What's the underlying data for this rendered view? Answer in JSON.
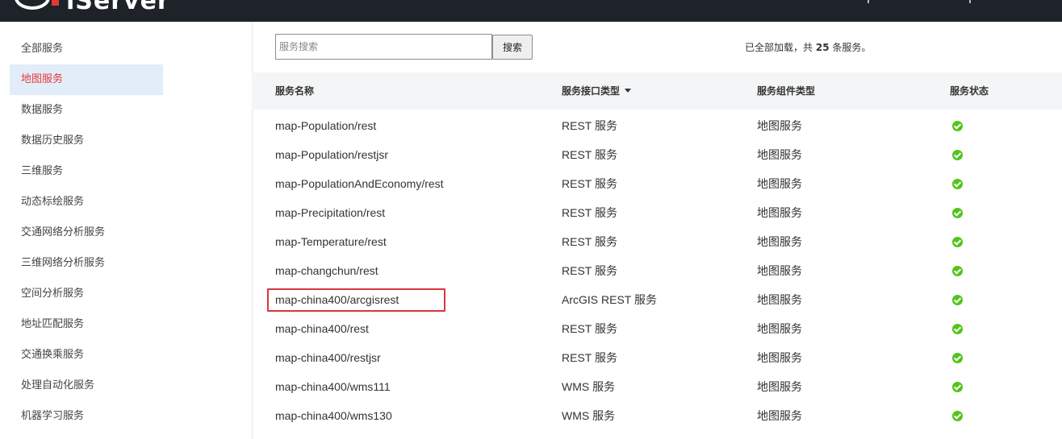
{
  "header": {
    "logo_text": "iServer"
  },
  "sidebar": {
    "items": [
      {
        "label": "全部服务"
      },
      {
        "label": "地图服务"
      },
      {
        "label": "数据服务"
      },
      {
        "label": "数据历史服务"
      },
      {
        "label": "三维服务"
      },
      {
        "label": "动态标绘服务"
      },
      {
        "label": "交通网络分析服务"
      },
      {
        "label": "三维网络分析服务"
      },
      {
        "label": "空间分析服务"
      },
      {
        "label": "地址匹配服务"
      },
      {
        "label": "交通换乘服务"
      },
      {
        "label": "处理自动化服务"
      },
      {
        "label": "机器学习服务"
      }
    ],
    "active_index": 1
  },
  "search": {
    "placeholder": "服务搜索",
    "value": "",
    "button_label": "搜索"
  },
  "summary": {
    "prefix": "已全部加载，共",
    "count": "25",
    "suffix": "条服务。"
  },
  "table": {
    "columns": [
      "服务名称",
      "服务接口类型",
      "服务组件类型",
      "服务状态"
    ],
    "sorted_column": "服务接口类型",
    "rows": [
      {
        "name": "map-Population/rest",
        "iface": "REST 服务",
        "comp": "地图服务",
        "status": "ok"
      },
      {
        "name": "map-Population/restjsr",
        "iface": "REST 服务",
        "comp": "地图服务",
        "status": "ok"
      },
      {
        "name": "map-PopulationAndEconomy/rest",
        "iface": "REST 服务",
        "comp": "地图服务",
        "status": "ok"
      },
      {
        "name": "map-Precipitation/rest",
        "iface": "REST 服务",
        "comp": "地图服务",
        "status": "ok"
      },
      {
        "name": "map-Temperature/rest",
        "iface": "REST 服务",
        "comp": "地图服务",
        "status": "ok"
      },
      {
        "name": "map-changchun/rest",
        "iface": "REST 服务",
        "comp": "地图服务",
        "status": "ok"
      },
      {
        "name": "map-china400/arcgisrest",
        "iface": "ArcGIS REST 服务",
        "comp": "地图服务",
        "status": "ok"
      },
      {
        "name": "map-china400/rest",
        "iface": "REST 服务",
        "comp": "地图服务",
        "status": "ok"
      },
      {
        "name": "map-china400/restjsr",
        "iface": "REST 服务",
        "comp": "地图服务",
        "status": "ok"
      },
      {
        "name": "map-china400/wms111",
        "iface": "WMS 服务",
        "comp": "地图服务",
        "status": "ok"
      },
      {
        "name": "map-china400/wms130",
        "iface": "WMS 服务",
        "comp": "地图服务",
        "status": "ok"
      }
    ],
    "highlighted_row": 6
  },
  "colors": {
    "topbar": "#1e2329",
    "active_text": "#e53935",
    "active_bg": "#e3edf9",
    "status_ok": "#52c41a",
    "highlight": "#d9363e"
  }
}
